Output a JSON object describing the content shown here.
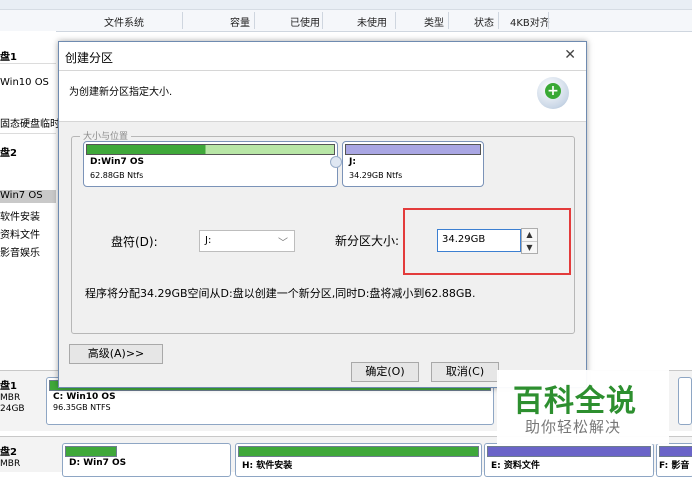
{
  "columns": [
    "文件系统",
    "容量",
    "已使用",
    "未使用",
    "类型",
    "状态",
    "4KB对齐"
  ],
  "left_tree": {
    "disk1_label": "盘1",
    "disk1_item": "Win10 OS",
    "temp_item": "固态硬盘临时",
    "disk2_label": "盘2",
    "items": [
      "Win7 OS",
      "软件安装",
      "资料文件",
      "影音娱乐"
    ]
  },
  "dialog": {
    "title": "创建分区",
    "description": "为创建新分区指定大小.",
    "group_label": "大小与位置",
    "part_left": {
      "name": "D:Win7 OS",
      "size": "62.88GB Ntfs",
      "fill": 0.48,
      "color": "#3fa83a"
    },
    "part_right": {
      "name": "J:",
      "size": "34.29GB Ntfs",
      "color": "#a9a6e3"
    },
    "drive_letter_label": "盘符(D):",
    "drive_letter_value": "J:",
    "new_size_label": "新分区大小:",
    "new_size_value": "34.29GB",
    "info": "程序将分配34.29GB空间从D:盘以创建一个新分区,同时D:盘将减小到62.88GB.",
    "advanced_button": "高级(A)>>",
    "ok_button": "确定(O)",
    "cancel_button": "取消(C)"
  },
  "disk_rows": {
    "disk1": {
      "label": "盘1",
      "type": "MBR",
      "size": "24GB",
      "part_name": "C: Win10 OS",
      "part_size": "96.35GB NTFS"
    },
    "disk2": {
      "label": "盘2",
      "type": "MBR",
      "parts": [
        "D: Win7 OS",
        "H: 软件安装",
        "E: 资料文件",
        "F: 影音"
      ]
    }
  },
  "watermark": {
    "title": "百科全说",
    "subtitle": "助你轻松解决"
  }
}
